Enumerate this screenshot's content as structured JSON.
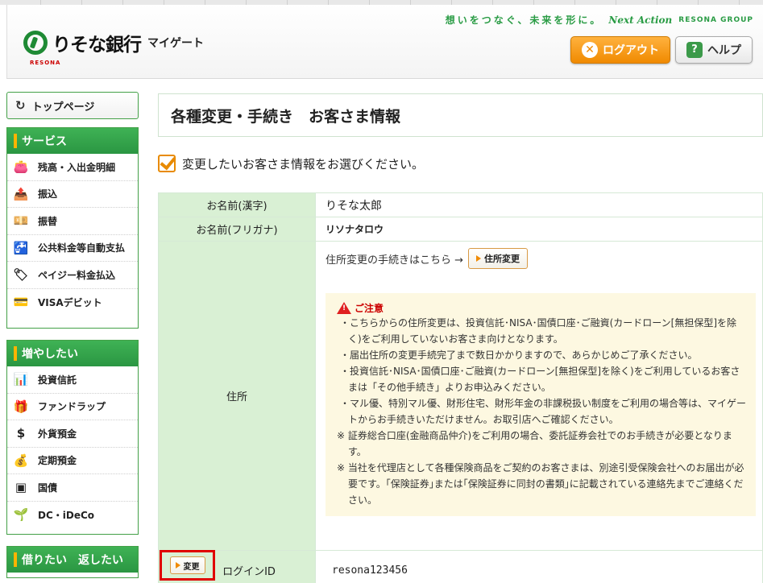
{
  "header": {
    "logo_name": "りそな銀行",
    "logo_sub": "RESONA",
    "logo_mygate": "マイゲート",
    "slogan": "想いをつなぐ、未来を形に。",
    "slogan_next": "Next Action",
    "slogan_group": "RESONA GROUP",
    "logout_label": "ログアウト",
    "help_label": "ヘルプ"
  },
  "sidebar": {
    "top_page": "トップページ",
    "services": {
      "title": "サービス",
      "items": [
        {
          "label": "残高・入出金明細",
          "icon": "wallet-icon",
          "glyph": "👛"
        },
        {
          "label": "振込",
          "icon": "transfer-icon",
          "glyph": "📤"
        },
        {
          "label": "振替",
          "icon": "exchange-icon",
          "glyph": "💴"
        },
        {
          "label": "公共料金等自動支払",
          "icon": "faucet-icon",
          "glyph": "🚰"
        },
        {
          "label": "ペイジー料金払込",
          "icon": "payeasy-icon",
          "glyph": "🏷"
        },
        {
          "label": "VISAデビット",
          "icon": "debit-card-icon",
          "glyph": "💳"
        }
      ]
    },
    "grow": {
      "title": "増やしたい",
      "items": [
        {
          "label": "投資信託",
          "icon": "bar-chart-icon",
          "glyph": "📊"
        },
        {
          "label": "ファンドラップ",
          "icon": "gift-icon",
          "glyph": "🎁"
        },
        {
          "label": "外貨預金",
          "icon": "dollar-icon",
          "glyph": "$"
        },
        {
          "label": "定期預金",
          "icon": "money-bag-icon",
          "glyph": "💰"
        },
        {
          "label": "国債",
          "icon": "bond-icon",
          "glyph": "▣"
        },
        {
          "label": "DC・iDeCo",
          "icon": "sprout-icon",
          "glyph": "🌱"
        }
      ]
    },
    "borrow": {
      "title": "借りたい　返したい"
    }
  },
  "main": {
    "page_title": "各種変更・手続き　お客さま情報",
    "instruction": "変更したいお客さま情報をお選びください。",
    "rows": {
      "name_kanji_label": "お名前(漢字)",
      "name_kanji_value": "りそな太郎",
      "name_kana_label": "お名前(フリガナ)",
      "name_kana_value": "リソナタロウ",
      "address_label": "住所",
      "address_link_text": "住所変更の手続きはこちら →",
      "address_button": "住所変更",
      "login_id_label": "ログインID",
      "login_id_value": "resona123456",
      "change_button": "変更"
    },
    "caution": {
      "title": "ご注意",
      "items": [
        "・こちらからの住所変更は、投資信託･NISA･国債口座･ご融資(カードローン[無担保型]を除く)をご利用していないお客さま向けとなります。",
        "・届出住所の変更手続完了まで数日かかりますので、あらかじめご了承ください。",
        "・投資信託･NISA･国債口座･ご融資(カードローン[無担保型]を除く)をご利用しているお客さまは「その他手続き」よりお申込みください。",
        "・マル優、特別マル優、財形住宅、財形年金の非課税扱い制度をご利用の場合等は、マイゲートからお手続きいただけません。お取引店へご確認ください。"
      ],
      "notes": [
        "※ 証券総合口座(金融商品仲介)をご利用の場合、委託証券会社でのお手続きが必要となります。",
        "※ 当社を代理店として各種保険商品をご契約のお客さまは、別途引受保険会社へのお届出が必要です。｢保険証券｣または｢保険証券に同封の書類｣に記載されている連絡先までご連絡ください。"
      ]
    }
  }
}
